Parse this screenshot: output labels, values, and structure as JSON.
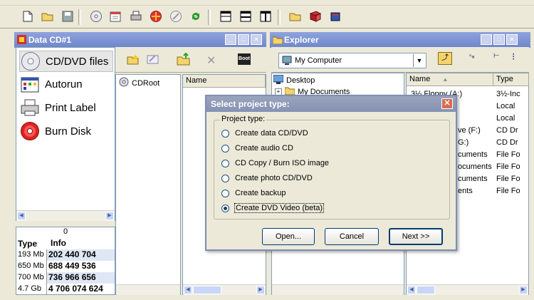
{
  "window": {
    "left_panel_title": "Data CD#1",
    "right_panel_title": "Explorer"
  },
  "toolbar": {
    "icons": [
      "new-icon",
      "open-folder-icon",
      "save-icon",
      "disc-icon",
      "calendar-icon",
      "print-icon",
      "burn-icon",
      "erase-icon",
      "refresh-icon",
      "tile-icon",
      "split-horizontal-icon",
      "split-vertical-icon",
      "folder-icon",
      "book-icon",
      "cube-icon"
    ]
  },
  "sidebar": {
    "items": [
      {
        "label": "CD/DVD files",
        "icon": "cd-icon",
        "selected": true
      },
      {
        "label": "Autorun",
        "icon": "autorun-icon",
        "selected": false
      },
      {
        "label": "Print Label",
        "icon": "printer-icon",
        "selected": false
      },
      {
        "label": "Burn Disk",
        "icon": "burn-disc-icon",
        "selected": false
      }
    ]
  },
  "stats": {
    "counter": "0",
    "col_type": "Type",
    "col_info": "Info",
    "rows": [
      {
        "type": "193 Mb",
        "info": "202 440 704"
      },
      {
        "type": "650 Mb",
        "info": "688 449 536"
      },
      {
        "type": "700 Mb",
        "info": "736 966 656"
      },
      {
        "type": "4.7 Gb",
        "info": "4 706 074 624"
      }
    ]
  },
  "project": {
    "boot_label": "Boot",
    "tree_root": "CDRoot",
    "list_col_name": "Name"
  },
  "explorer": {
    "location": "My Computer",
    "tree": [
      {
        "label": "Desktop"
      },
      {
        "label": "My Documents"
      }
    ],
    "list_headers": {
      "name": "Name",
      "type": "Type"
    },
    "list_rows": [
      {
        "name": "3½ Floppy (A:)",
        "type": "3½-Inc"
      },
      {
        "name": "",
        "type": "Local"
      },
      {
        "name": "",
        "type": "Local"
      },
      {
        "name": "ve (F:)",
        "type": "CD Dr"
      },
      {
        "name": "G:)",
        "type": "CD Dr"
      },
      {
        "name": "cuments",
        "type": "File Fo"
      },
      {
        "name": "ocuments",
        "type": "File Fo"
      },
      {
        "name": "cuments",
        "type": "File Fo"
      },
      {
        "name": "ents",
        "type": "File Fo"
      }
    ]
  },
  "dialog": {
    "title": "Select project type:",
    "group_label": "Project type:",
    "options": [
      {
        "label": "Create data CD/DVD",
        "checked": false
      },
      {
        "label": "Create audio CD",
        "checked": false
      },
      {
        "label": "CD Copy / Burn ISO image",
        "checked": false
      },
      {
        "label": "Create photo CD/DVD",
        "checked": false
      },
      {
        "label": "Create backup",
        "checked": false
      },
      {
        "label": "Create DVD Video (beta)",
        "checked": true
      }
    ],
    "buttons": {
      "open": "Open...",
      "cancel": "Cancel",
      "next": "Next >>"
    }
  }
}
